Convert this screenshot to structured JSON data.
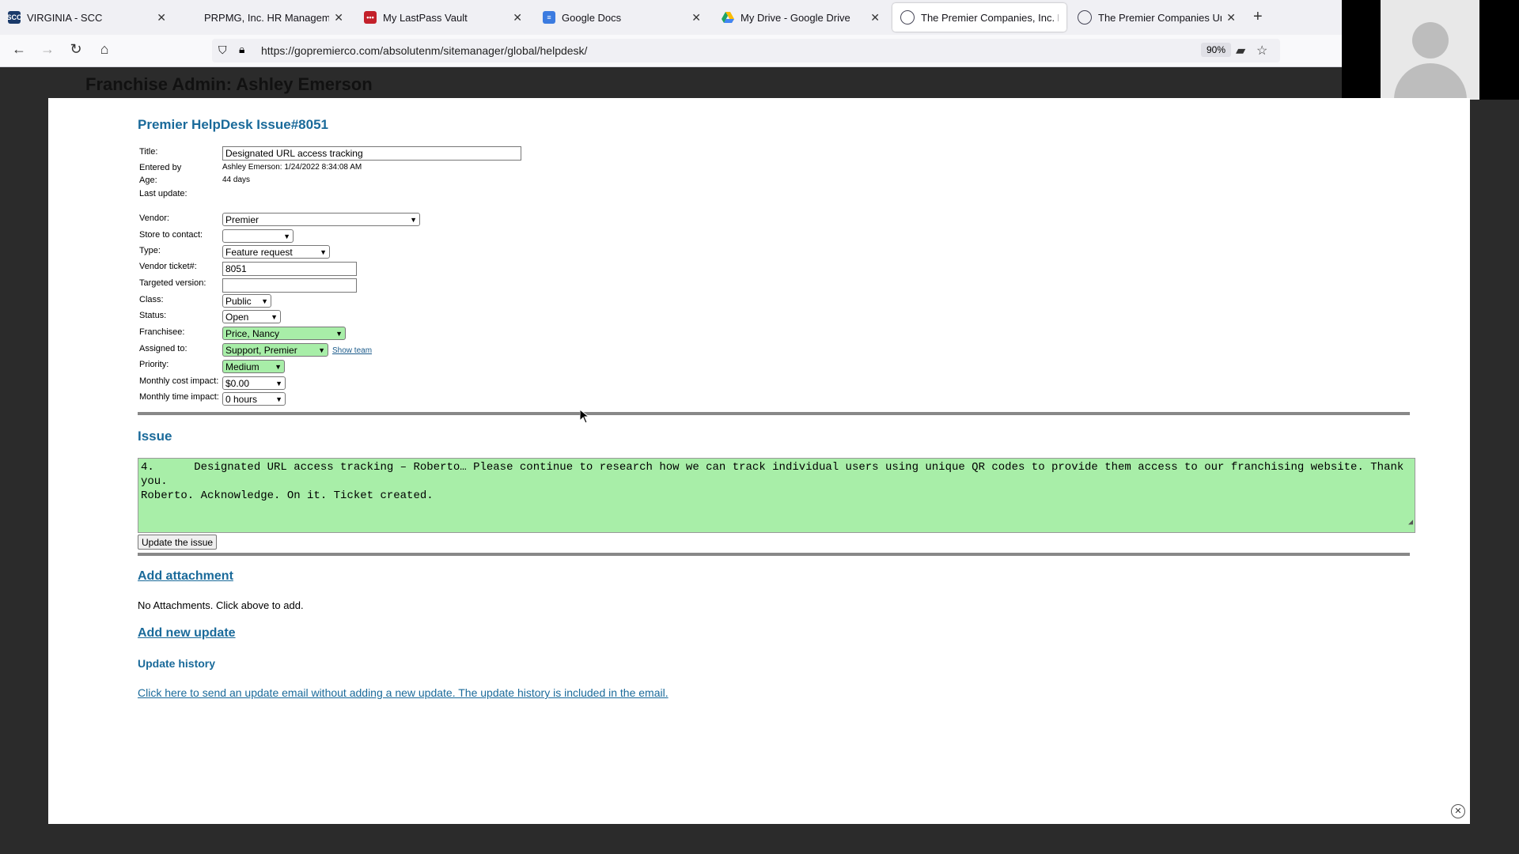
{
  "browser": {
    "tabs": [
      {
        "label": "VIRGINIA - SCC",
        "icon": "scc-icon"
      },
      {
        "label": "PRPMG, Inc. HR Management Syste",
        "icon": "hr-icon"
      },
      {
        "label": "My LastPass Vault",
        "icon": "lastpass-icon"
      },
      {
        "label": "Google Docs",
        "icon": "docs-icon"
      },
      {
        "label": "My Drive - Google Drive",
        "icon": "drive-icon"
      },
      {
        "label": "The Premier Companies, Inc. Fr",
        "icon": "premier-icon"
      },
      {
        "label": "The Premier Companies Unsub",
        "icon": "premier-icon"
      }
    ],
    "url": "https://gopremierco.com/absolutenm/sitemanager/global/helpdesk/",
    "zoom": "90%"
  },
  "backdrop": {
    "title": "Franchise Admin: Ashley Emerson"
  },
  "form": {
    "page_title": "Premier HelpDesk Issue#8051",
    "labels": {
      "title": "Title:",
      "entered_by": "Entered by",
      "age": "Age:",
      "last_update": "Last update:",
      "vendor": "Vendor:",
      "store": "Store to contact:",
      "type": "Type:",
      "vendor_ticket": "Vendor ticket#:",
      "targeted_version": "Targeted version:",
      "class": "Class:",
      "status": "Status:",
      "franchisee": "Franchisee:",
      "assigned_to": "Assigned to:",
      "priority": "Priority:",
      "cost_impact": "Monthly cost impact:",
      "time_impact": "Monthly time impact:"
    },
    "values": {
      "title": "Designated URL access tracking",
      "entered_by": "Ashley Emerson: 1/24/2022 8:34:08 AM",
      "age": "44 days",
      "last_update": "",
      "vendor": "Premier",
      "store": "",
      "type": "Feature request",
      "vendor_ticket": "8051",
      "targeted_version": "",
      "class": "Public",
      "status": "Open",
      "franchisee": "Price, Nancy",
      "assigned_to": "Support, Premier",
      "priority": "Medium",
      "cost_impact": "$0.00",
      "time_impact": "0 hours"
    },
    "show_team": "Show team"
  },
  "issue": {
    "heading": "Issue",
    "text": "4.\tDesignated URL access tracking – Roberto… Please continue to research how we can track individual users using unique QR codes to provide them access to our franchising website. Thank you.\nRoberto. Acknowledge. On it. Ticket created.",
    "update_button": "Update the issue"
  },
  "attachments": {
    "add_link": "Add attachment",
    "none_text": "No Attachments. Click above to add."
  },
  "updates": {
    "add_link": "Add new update",
    "history_heading": "Update history",
    "email_link": "Click here to send an update email without adding a new update. The update history is included in the email."
  },
  "colors": {
    "accent": "#1a6a9a",
    "highlight": "#a8eea8"
  }
}
